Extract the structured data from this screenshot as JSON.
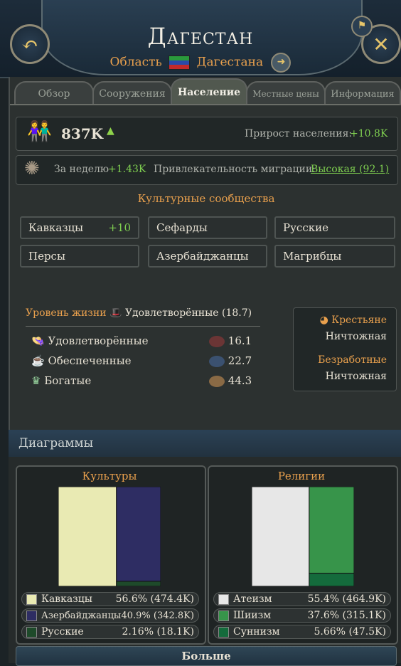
{
  "header": {
    "title": "Дагестан",
    "region_prefix": "Область",
    "region_name": "Дагестана"
  },
  "tabs": [
    "Обзор",
    "Сооружения",
    "Население",
    "Местные цены",
    "Информация"
  ],
  "population": {
    "total": "837K",
    "growth_label": "Прирост населения:",
    "growth_value": "+10.8K",
    "weekly_label": "За неделю",
    "weekly_value": "+1.43K",
    "migration_label": "Привлекательность миграции:",
    "migration_value": "Высокая (92.1)"
  },
  "cultures": {
    "title": "Культурные сообщества",
    "items": [
      {
        "name": "Кавказцы",
        "value": "+10"
      },
      {
        "name": "Сефарды",
        "value": ""
      },
      {
        "name": "Русские",
        "value": ""
      },
      {
        "name": "Персы",
        "value": ""
      },
      {
        "name": "Азербайджанцы",
        "value": ""
      },
      {
        "name": "Магрибцы",
        "value": ""
      }
    ]
  },
  "living": {
    "label": "Уровень жизни",
    "value": "Удовлетворённые (18.7)",
    "rows": [
      {
        "name": "Удовлетворённые",
        "value": "16.1"
      },
      {
        "name": "Обеспеченные",
        "value": "22.7"
      },
      {
        "name": "Богатые",
        "value": "44.3"
      }
    ],
    "side": {
      "peasants_label": "Крестьяне",
      "peasants_value": "Ничтожная",
      "unemployed_label": "Безработные",
      "unemployed_value": "Ничтожная"
    }
  },
  "diagrams": {
    "title": "Диаграммы",
    "more_label": "Больше"
  },
  "chart_data": [
    {
      "type": "bar",
      "title": "Культуры",
      "series": [
        {
          "name": "Кавказцы",
          "percent": 56.6,
          "value_label": "56.6% (474.4K)",
          "color": "#e9eab3"
        },
        {
          "name": "Азербайджанцы",
          "percent": 40.9,
          "value_label": "40.9% (342.8K)",
          "color": "#2e2d63"
        },
        {
          "name": "Русские",
          "percent": 2.16,
          "value_label": "2.16% (18.1K)",
          "color": "#1e4a2a"
        }
      ]
    },
    {
      "type": "bar",
      "title": "Религии",
      "series": [
        {
          "name": "Атеизм",
          "percent": 55.4,
          "value_label": "55.4% (464.9K)",
          "color": "#e7e7e7"
        },
        {
          "name": "Шиизм",
          "percent": 37.6,
          "value_label": "37.6% (315.1K)",
          "color": "#37944a"
        },
        {
          "name": "Суннизм",
          "percent": 5.66,
          "value_label": "5.66% (47.5K)",
          "color": "#146b3c"
        }
      ]
    }
  ]
}
